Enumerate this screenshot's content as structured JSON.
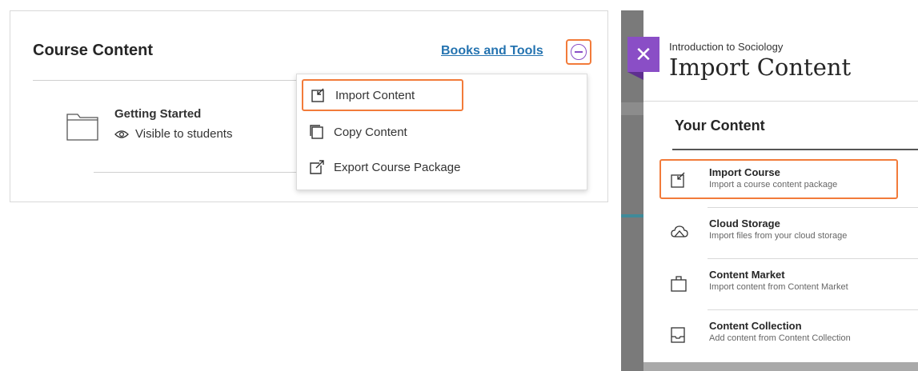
{
  "course": {
    "title": "Course Content",
    "books_tools_label": "Books and Tools",
    "item": {
      "title": "Getting Started",
      "visibility": "Visible to students"
    }
  },
  "menu": {
    "items": [
      {
        "label": "Import Content",
        "icon": "import-icon"
      },
      {
        "label": "Copy Content",
        "icon": "copy-icon"
      },
      {
        "label": "Export Course Package",
        "icon": "export-icon"
      }
    ]
  },
  "import_panel": {
    "course_name": "Introduction to Sociology",
    "title": "Import Content",
    "section_title": "Your Content",
    "sources": [
      {
        "name": "Import Course",
        "desc": "Import a course content package",
        "icon": "import-icon"
      },
      {
        "name": "Cloud Storage",
        "desc": "Import files from your cloud storage",
        "icon": "cloud-icon"
      },
      {
        "name": "Content Market",
        "desc": "Import content from Content Market",
        "icon": "briefcase-icon"
      },
      {
        "name": "Content Collection",
        "desc": "Add content from Content Collection",
        "icon": "inbox-tray-icon"
      }
    ]
  },
  "colors": {
    "highlight": "#f27b3a",
    "accent_purple": "#8a4ec6",
    "link": "#2473b0"
  }
}
